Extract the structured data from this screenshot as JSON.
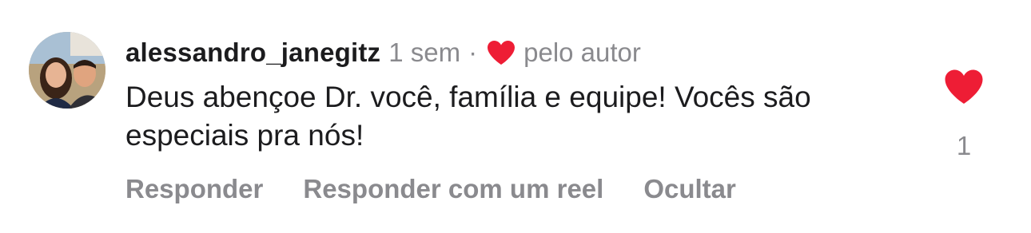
{
  "comment": {
    "username": "alessandro_janegitz",
    "time": "1 sem",
    "separator": "·",
    "author_liked_label": "pelo autor",
    "text": "Deus abençoe Dr. você, família e equipe! Vocês são especiais pra nós!",
    "like_count": "1"
  },
  "actions": {
    "reply": "Responder",
    "reply_reel": "Responder com um reel",
    "hide": "Ocultar"
  },
  "icons": {
    "author_heart": "heart-icon",
    "like_heart": "heart-icon"
  },
  "colors": {
    "heart": "#ee1d35",
    "text": "#1c1c1e",
    "secondary": "#8a8a8e"
  }
}
